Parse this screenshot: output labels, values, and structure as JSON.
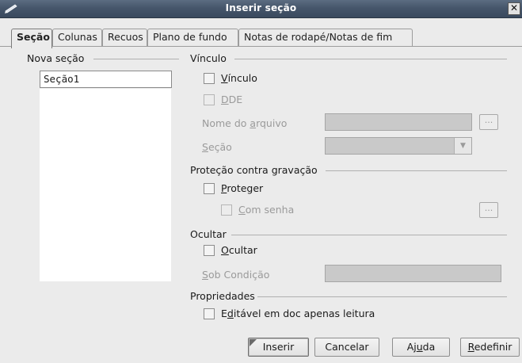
{
  "window": {
    "title": "Inserir seção",
    "close_symbol": "✕",
    "app_icon": "writer-icon"
  },
  "tabs": [
    {
      "label": "Seção",
      "active": true
    },
    {
      "label": "Colunas",
      "active": false
    },
    {
      "label": "Recuos",
      "active": false
    },
    {
      "label": "Plano de fundo",
      "active": false
    },
    {
      "label": "Notas de rodapé/Notas de fim",
      "active": false
    }
  ],
  "new_section": {
    "heading": "Nova seção",
    "name_value": "Seção1",
    "items": []
  },
  "link": {
    "heading": "Vínculo",
    "link_checkbox": {
      "pre": "",
      "key": "V",
      "post": "ínculo",
      "checked": false
    },
    "dde_checkbox": {
      "pre": "",
      "key": "D",
      "post": "DE",
      "checked": false
    },
    "filename_label": {
      "pre": "Nome do ",
      "key": "a",
      "post": "rquivo"
    },
    "filename_value": "",
    "browse_label": "...",
    "section_label": {
      "pre": "",
      "key": "S",
      "post": "eção"
    },
    "section_value": "",
    "dropdown_arrow": "▼"
  },
  "write_protection": {
    "heading": "Proteção contra gravação",
    "protect_checkbox": {
      "pre": "",
      "key": "P",
      "post": "roteger",
      "checked": false
    },
    "password_checkbox": {
      "pre": "",
      "key": "C",
      "post": "om senha",
      "checked": false
    },
    "password_button": "..."
  },
  "hide": {
    "heading": "Ocultar",
    "hide_checkbox": {
      "pre": "",
      "key": "O",
      "post": "cultar",
      "checked": false
    },
    "condition_label": {
      "pre": "",
      "key": "S",
      "post": "ob Condição"
    },
    "condition_value": ""
  },
  "properties": {
    "heading": "Propriedades",
    "editable_checkbox": {
      "pre": "E",
      "key": "d",
      "post": "itável em doc apenas leitura",
      "checked": false
    }
  },
  "buttons": {
    "insert": {
      "pre": "",
      "key": "",
      "post": "Inserir"
    },
    "cancel": {
      "pre": "",
      "key": "",
      "post": "Cancelar"
    },
    "help": {
      "pre": "Aj",
      "key": "u",
      "post": "da"
    },
    "reset": {
      "pre": "",
      "key": "R",
      "post": "edefinir"
    }
  }
}
